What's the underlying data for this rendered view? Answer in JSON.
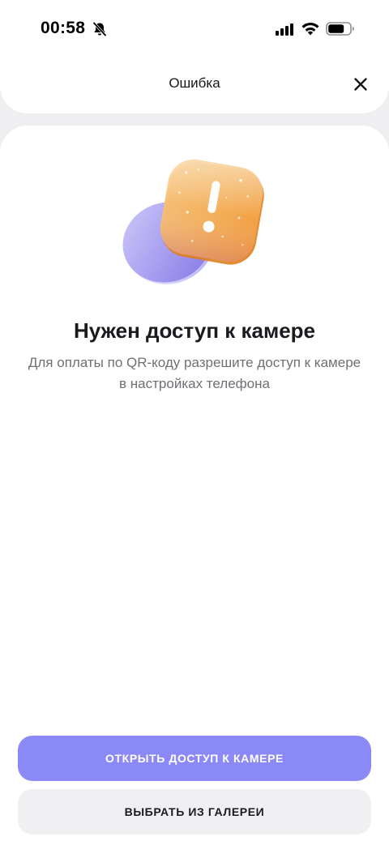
{
  "status_bar": {
    "time": "00:58",
    "icons": [
      "bell-slash-icon",
      "cellular-signal-icon",
      "wifi-icon",
      "battery-icon"
    ]
  },
  "header": {
    "title": "Ошибка",
    "close_icon": "close-icon"
  },
  "illustration": {
    "icon": "warning-exclamation-icon"
  },
  "message": {
    "heading": "Нужен доступ к камере",
    "body_lines": [
      "Для оплаты по QR-коду разрешите доступ к камере",
      "в настройках телефона"
    ]
  },
  "actions": {
    "primary_label": "ОТКРЫТЬ ДОСТУП К КАМЕРЕ",
    "secondary_label": "ВЫБРАТЬ ИЗ ГАЛЕРЕИ"
  },
  "colors": {
    "background": "#efeff2",
    "card": "#ffffff",
    "primary_button": "#8b88f8",
    "secondary_button": "#f0f0f3",
    "accent_orange": "#f5a742",
    "accent_lilac": "#a59cf0"
  }
}
